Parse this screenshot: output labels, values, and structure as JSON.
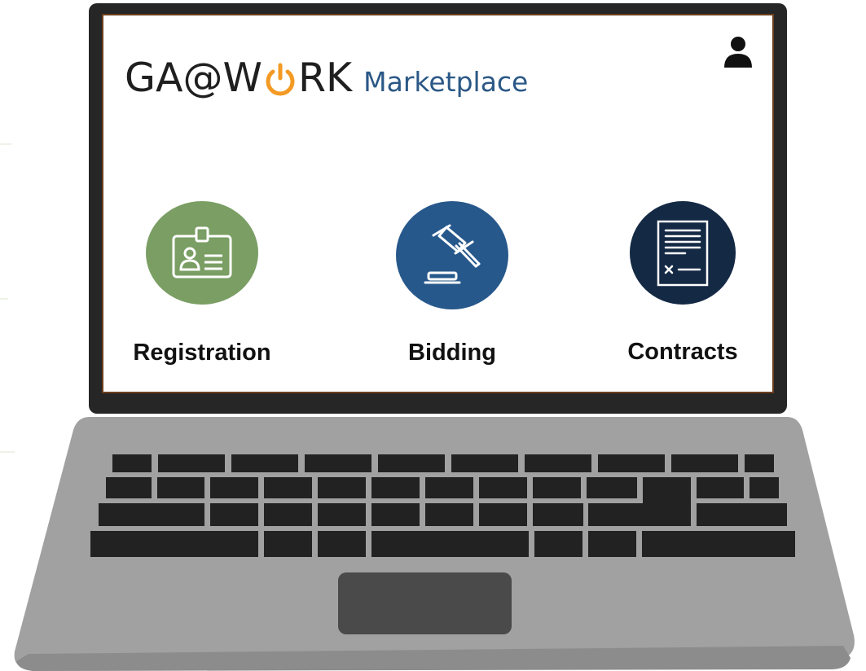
{
  "app": {
    "logo_text_left": "GA@W",
    "logo_text_right": "RK",
    "logo_subtitle": "Marketplace"
  },
  "header": {
    "user_icon": "user-icon"
  },
  "tiles": [
    {
      "label": "Registration",
      "icon": "id-badge-icon",
      "color": "#7a9e63"
    },
    {
      "label": "Bidding",
      "icon": "gavel-icon",
      "color": "#27588b"
    },
    {
      "label": "Contracts",
      "icon": "contract-document-icon",
      "color": "#142944"
    }
  ],
  "colors": {
    "logo_accent": "#f39a24",
    "laptop_body": "#a3a3a3",
    "screen_bezel": "#262626",
    "screen_border": "#6b3f1d"
  }
}
